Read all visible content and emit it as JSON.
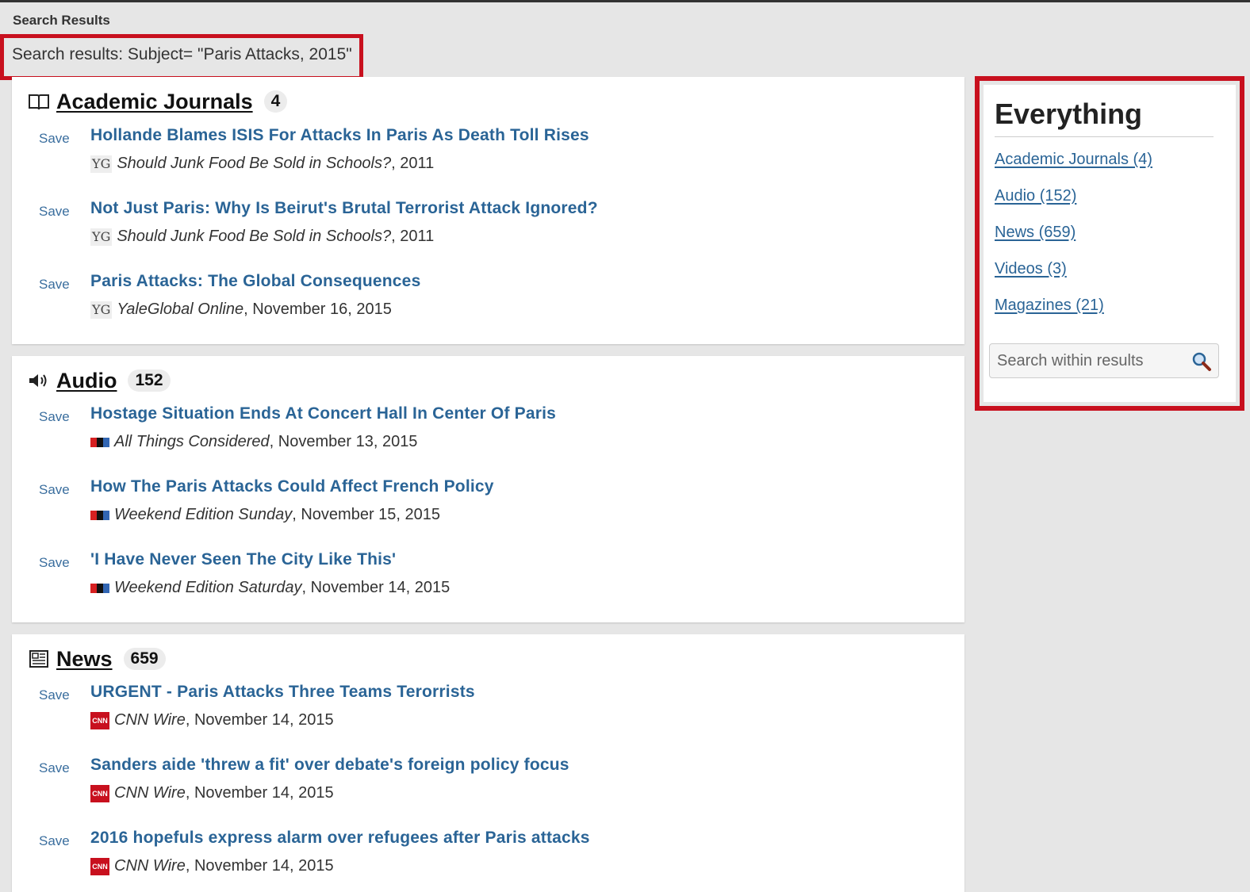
{
  "page": {
    "label": "Search Results",
    "query": "Search results: Subject= \"Paris Attacks, 2015\""
  },
  "sections": [
    {
      "title": "Academic Journals",
      "count": "4",
      "icon": "book-icon",
      "items": [
        {
          "save": "Save",
          "title": "Hollande Blames ISIS For Attacks In Paris As Death Toll Rises",
          "publication": "Should Junk Food Be Sold in Schools?",
          "date": ", 2011",
          "logo": "yg-logo"
        },
        {
          "save": "Save",
          "title": "Not Just Paris: Why Is Beirut's Brutal Terrorist Attack Ignored?",
          "publication": "Should Junk Food Be Sold in Schools?",
          "date": ", 2011",
          "logo": "yg-logo"
        },
        {
          "save": "Save",
          "title": "Paris Attacks: The Global Consequences",
          "publication": "YaleGlobal Online",
          "date": ", November 16, 2015",
          "logo": "yg-logo"
        }
      ]
    },
    {
      "title": "Audio",
      "count": "152",
      "icon": "speaker-icon",
      "items": [
        {
          "save": "Save",
          "title": "Hostage Situation Ends At Concert Hall In Center Of Paris",
          "publication": "All Things Considered",
          "date": ", November 13, 2015",
          "logo": "npr-logo"
        },
        {
          "save": "Save",
          "title": "How The Paris Attacks Could Affect French Policy",
          "publication": "Weekend Edition Sunday",
          "date": ", November 15, 2015",
          "logo": "npr-logo"
        },
        {
          "save": "Save",
          "title": "'I Have Never Seen The City Like This'",
          "publication": "Weekend Edition Saturday",
          "date": ", November 14, 2015",
          "logo": "npr-logo"
        }
      ]
    },
    {
      "title": "News",
      "count": "659",
      "icon": "newspaper-icon",
      "items": [
        {
          "save": "Save",
          "title": "URGENT - Paris Attacks Three Teams Terorrists",
          "publication": "CNN Wire",
          "date": ", November 14, 2015",
          "logo": "cnn-logo"
        },
        {
          "save": "Save",
          "title": "Sanders aide 'threw a fit' over debate's foreign policy focus",
          "publication": "CNN Wire",
          "date": ", November 14, 2015",
          "logo": "cnn-logo"
        },
        {
          "save": "Save",
          "title": "2016 hopefuls express alarm over refugees after Paris attacks",
          "publication": "CNN Wire",
          "date": ", November 14, 2015",
          "logo": "cnn-logo"
        }
      ]
    }
  ],
  "sidebar": {
    "title": "Everything",
    "links": [
      "Academic Journals (4)",
      "Audio (152)",
      "News (659)",
      "Videos (3)",
      "Magazines (21)"
    ],
    "search_placeholder": "Search within results"
  },
  "logos": {
    "yg": "YG",
    "cnn": "CNN"
  },
  "colors": {
    "highlight_border": "#c8101e",
    "link": "#2a6496",
    "background": "#e6e6e6"
  }
}
